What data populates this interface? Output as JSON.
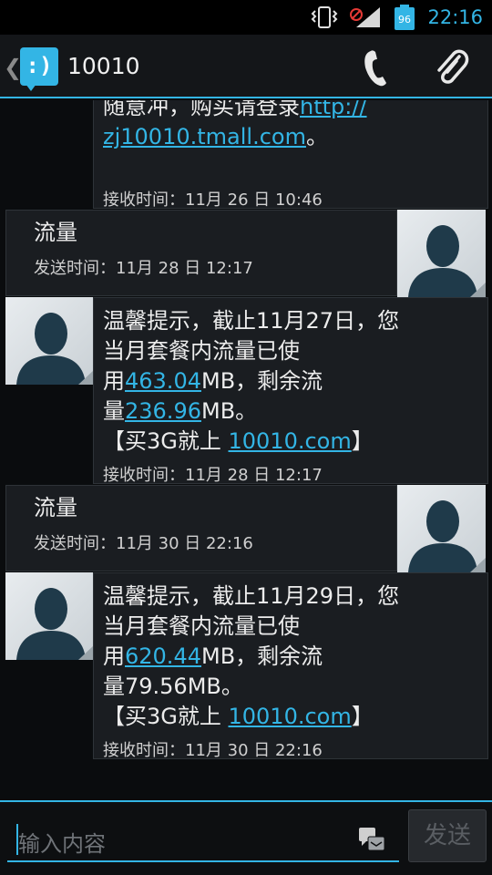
{
  "status_bar": {
    "battery_level": "96",
    "time": "22:16"
  },
  "action_bar": {
    "title": "10010"
  },
  "messages": [
    {
      "direction": "received",
      "lines": [
        "随意冲，购买请登录",
        "http://",
        "zj10010.tmall.com",
        "。"
      ],
      "meta": "接收时间：11月 26 日 10:46"
    },
    {
      "direction": "sent",
      "text": "流量",
      "meta": "发送时间：11月 28 日 12:17"
    },
    {
      "direction": "received",
      "line1": "温馨提示，截止11月27日，您",
      "line2": "当月套餐内流量已使",
      "line3_pre": "用",
      "line3_link": "463.04",
      "line3_post": "MB，剩余流",
      "line4_pre": "量",
      "line4_link": "236.96",
      "line4_post": "MB。",
      "line5_pre": "【买3G就上 ",
      "line5_link": "10010.com",
      "line5_post": "】",
      "meta": "接收时间：11月 28 日 12:17"
    },
    {
      "direction": "sent",
      "text": "流量",
      "meta": "发送时间：11月 30 日 22:16"
    },
    {
      "direction": "received",
      "line1": "温馨提示，截止11月29日，您",
      "line2": "当月套餐内流量已使",
      "line3_pre": "用",
      "line3_link": "620.44",
      "line3_post": "MB，剩余流",
      "line4_pre": "量79.56MB。",
      "line5_pre": "【买3G就上 ",
      "line5_link": "10010.com",
      "line5_post": "】",
      "meta": "接收时间：11月 30 日 22:16"
    }
  ],
  "compose": {
    "placeholder": "输入内容",
    "send_label": "发送"
  },
  "colors": {
    "accent": "#33b5e5",
    "background": "#0a0c0e",
    "bubble": "#1a1d21"
  }
}
